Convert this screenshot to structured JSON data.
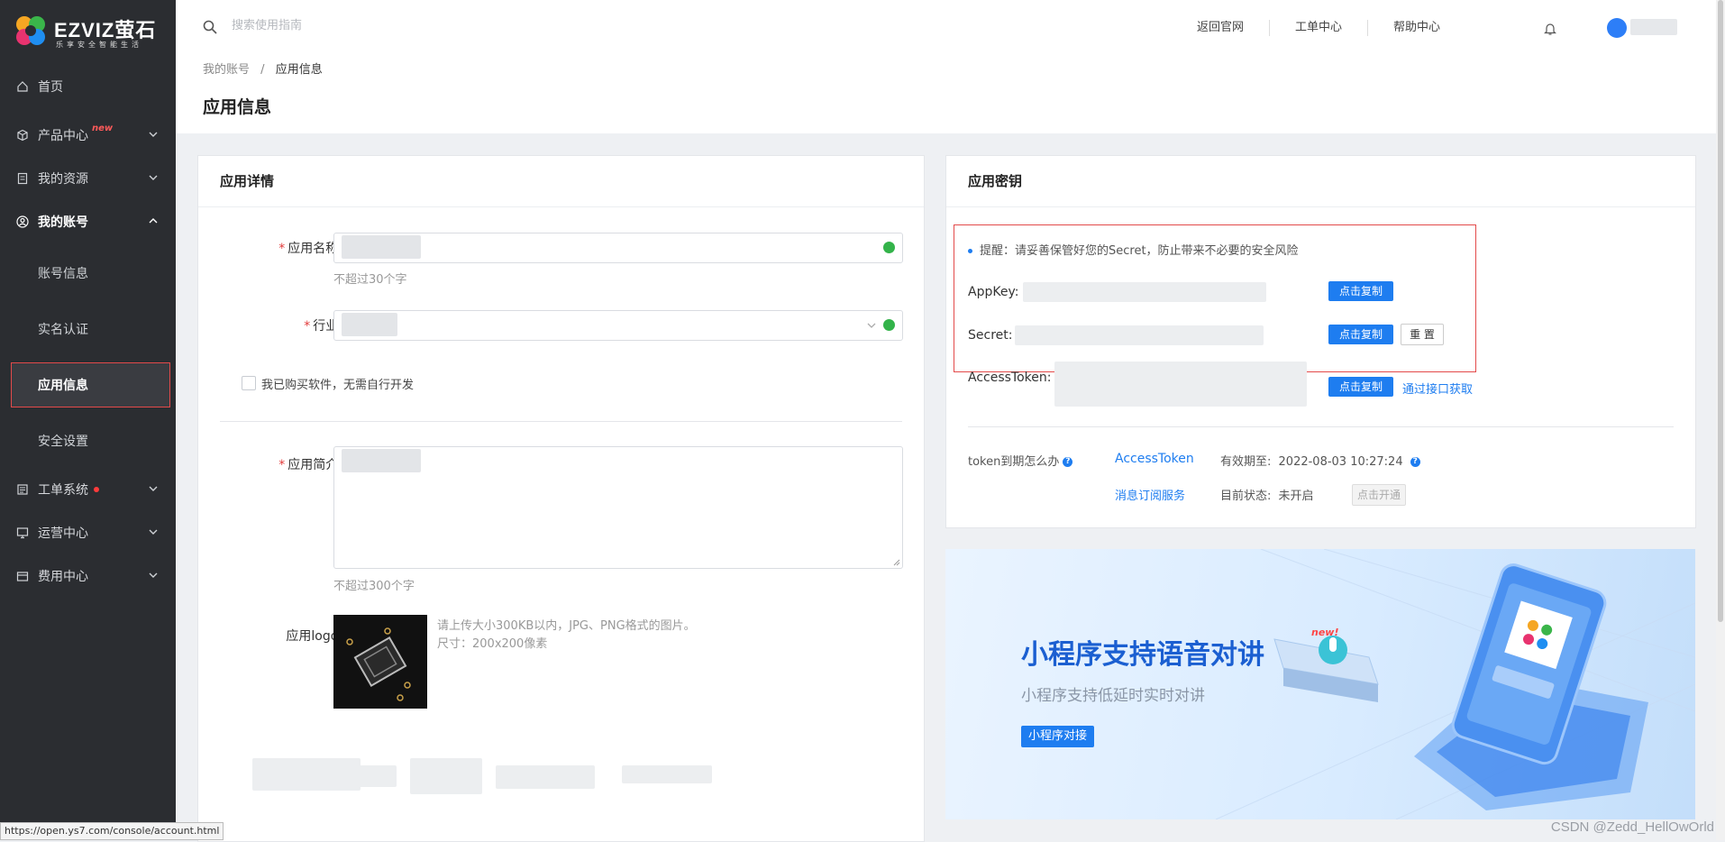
{
  "brand": {
    "name": "EZVIZ萤石",
    "slogan": "乐享安全智能生活"
  },
  "sidebar": {
    "items": [
      {
        "label": "首页",
        "icon": "home-icon"
      },
      {
        "label": "产品中心",
        "icon": "box-icon",
        "badge": "new"
      },
      {
        "label": "我的资源",
        "icon": "document-icon"
      },
      {
        "label": "我的账号",
        "icon": "user-circle-icon"
      },
      {
        "label": "工单系统",
        "icon": "list-icon"
      },
      {
        "label": "运营中心",
        "icon": "monitor-icon"
      },
      {
        "label": "费用中心",
        "icon": "wallet-icon"
      }
    ],
    "sub_items": [
      {
        "label": "账号信息"
      },
      {
        "label": "实名认证"
      },
      {
        "label": "应用信息"
      },
      {
        "label": "安全设置"
      }
    ]
  },
  "status_url": "https://open.ys7.com/console/account.html",
  "header": {
    "search_placeholder": "搜索使用指南",
    "links": [
      "返回官网",
      "工单中心",
      "帮助中心"
    ]
  },
  "breadcrumb": {
    "parent": "我的账号",
    "separator": "/",
    "current": "应用信息"
  },
  "page_title": "应用信息",
  "app_details": {
    "title": "应用详情",
    "name_label": "应用名称:",
    "name_hint": "不超过30个字",
    "industry_label": "行业:",
    "purchased_checkbox": "我已购买软件，无需自行开发",
    "intro_label": "应用简介:",
    "intro_hint": "不超过300个字",
    "logo_label": "应用logo:",
    "logo_hint": "请上传大小300KB以内，JPG、PNG格式的图片。尺寸：200x200像素"
  },
  "app_keys": {
    "title": "应用密钥",
    "tip": "提醒：请妥善保管好您的Secret，防止带来不必要的安全风险",
    "appkey_label": "AppKey:",
    "secret_label": "Secret:",
    "token_label": "AccessToken:",
    "copy_label": "点击复制",
    "reset_label": "重 置",
    "fetch_link": "通过接口获取",
    "expire_question": "token到期怎么办",
    "token_link": "AccessToken",
    "valid_until_label": "有效期至:",
    "valid_until_value": "2022-08-03 10:27:24",
    "subscription_link": "消息订阅服务",
    "status_label": "目前状态:",
    "status_value": "未开启",
    "enable_label": "点击开通"
  },
  "banner": {
    "title": "小程序支持语音对讲",
    "new": "new!",
    "subtitle": "小程序支持低延时实时对讲",
    "button": "小程序对接"
  },
  "watermark": "CSDN @Zedd_HellOwOrld",
  "colors": {
    "primary": "#1e7df0",
    "sidebar_bg": "#2b2d31",
    "required": "#e23a3a",
    "success": "#33b34a"
  }
}
